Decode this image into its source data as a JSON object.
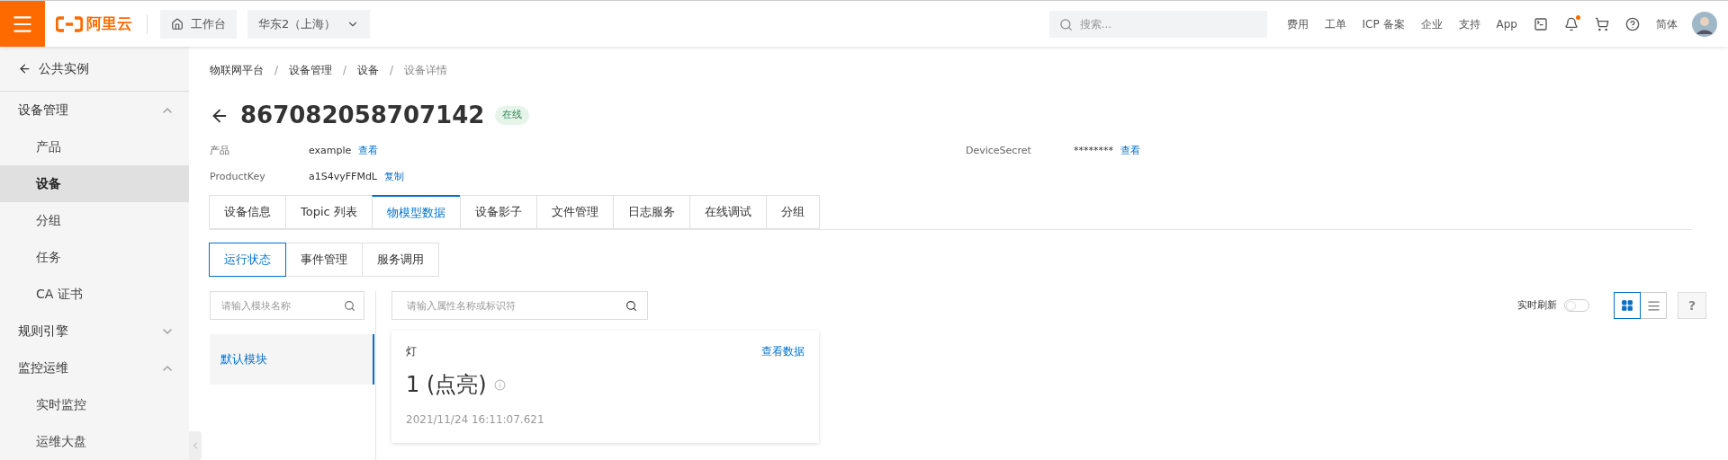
{
  "topbar": {
    "logo": "阿里云",
    "workbench": "工作台",
    "region": "华东2（上海）",
    "search": {
      "placeholder": "搜索..."
    },
    "links": [
      "费用",
      "工单",
      "ICP 备案",
      "企业",
      "支持",
      "App"
    ],
    "notification_dot": true,
    "language": "简体"
  },
  "sidebar": {
    "back": "公共实例",
    "items": [
      {
        "label": "设备管理",
        "expanded": true,
        "children": [
          {
            "label": "产品",
            "selected": false
          },
          {
            "label": "设备",
            "selected": true
          },
          {
            "label": "分组",
            "selected": false
          },
          {
            "label": "任务",
            "selected": false
          },
          {
            "label": "CA 证书",
            "selected": false
          }
        ]
      },
      {
        "label": "规则引擎",
        "expanded": false
      },
      {
        "label": "监控运维",
        "expanded": true,
        "children": [
          {
            "label": "实时监控",
            "selected": false
          },
          {
            "label": "运维大盘",
            "selected": false
          }
        ]
      }
    ]
  },
  "breadcrumb": [
    {
      "kind": "link",
      "text": "物联网平台"
    },
    {
      "kind": "separator",
      "text": "/"
    },
    {
      "kind": "link",
      "text": "设备管理"
    },
    {
      "kind": "separator",
      "text": "/"
    },
    {
      "kind": "link",
      "text": "设备"
    },
    {
      "kind": "separator",
      "text": "/"
    },
    {
      "kind": "current",
      "text": "设备详情"
    }
  ],
  "device": {
    "name": "867082058707142",
    "status": "在线",
    "fields": [
      {
        "label": "产品",
        "value": "example",
        "link": "查看"
      },
      {
        "label": "DeviceSecret",
        "value": "********",
        "link": "查看"
      },
      {
        "label": "ProductKey",
        "value": "a1S4vyFFMdL",
        "link": "复制"
      }
    ]
  },
  "tabs": [
    {
      "label": "设备信息",
      "selected": false
    },
    {
      "label": "Topic 列表",
      "selected": false
    },
    {
      "label": "物模型数据",
      "selected": true
    },
    {
      "label": "设备影子",
      "selected": false
    },
    {
      "label": "文件管理",
      "selected": false
    },
    {
      "label": "日志服务",
      "selected": false
    },
    {
      "label": "在线调试",
      "selected": false
    },
    {
      "label": "分组",
      "selected": false
    }
  ],
  "subtabs": [
    {
      "label": "运行状态",
      "selected": true
    },
    {
      "label": "事件管理",
      "selected": false
    },
    {
      "label": "服务调用",
      "selected": false
    }
  ],
  "module_search": {
    "placeholder": "请输入模块名称"
  },
  "modules": [
    {
      "label": "默认模块",
      "selected": true
    }
  ],
  "property_search": {
    "placeholder": "请输入属性名称或标识符"
  },
  "realtime_refresh": {
    "label": "实时刷新",
    "on": false
  },
  "views": [
    {
      "kind": "grid",
      "selected": true
    },
    {
      "kind": "list",
      "selected": false
    }
  ],
  "help": "?",
  "properties": [
    {
      "name": "灯",
      "link": "查看数据",
      "value": "1 (点亮)",
      "time": "2021/11/24 16:11:07.621"
    }
  ]
}
